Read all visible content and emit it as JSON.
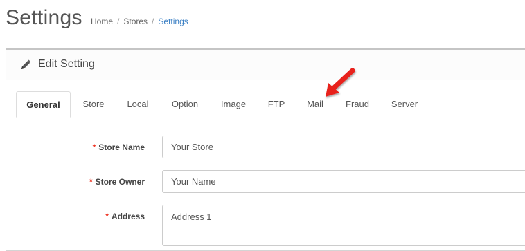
{
  "header": {
    "title": "Settings",
    "breadcrumb": [
      {
        "label": "Home"
      },
      {
        "label": "Stores"
      },
      {
        "label": "Settings"
      }
    ]
  },
  "panel": {
    "title": "Edit Setting",
    "icon": "pencil-icon"
  },
  "tabs": [
    {
      "label": "General",
      "active": true
    },
    {
      "label": "Store"
    },
    {
      "label": "Local"
    },
    {
      "label": "Option"
    },
    {
      "label": "Image"
    },
    {
      "label": "FTP"
    },
    {
      "label": "Mail"
    },
    {
      "label": "Fraud"
    },
    {
      "label": "Server"
    }
  ],
  "form": {
    "store_name": {
      "label": "Store Name",
      "required_mark": "*",
      "value": "Your Store"
    },
    "store_owner": {
      "label": "Store Owner",
      "required_mark": "*",
      "value": "Your Name"
    },
    "address": {
      "label": "Address",
      "required_mark": "*",
      "value": "Address 1"
    }
  },
  "annotation": {
    "arrow_color": "#e8211c",
    "points_to": "Mail tab"
  },
  "colors": {
    "link": "#3a7fc4",
    "required": "#ee3322"
  }
}
